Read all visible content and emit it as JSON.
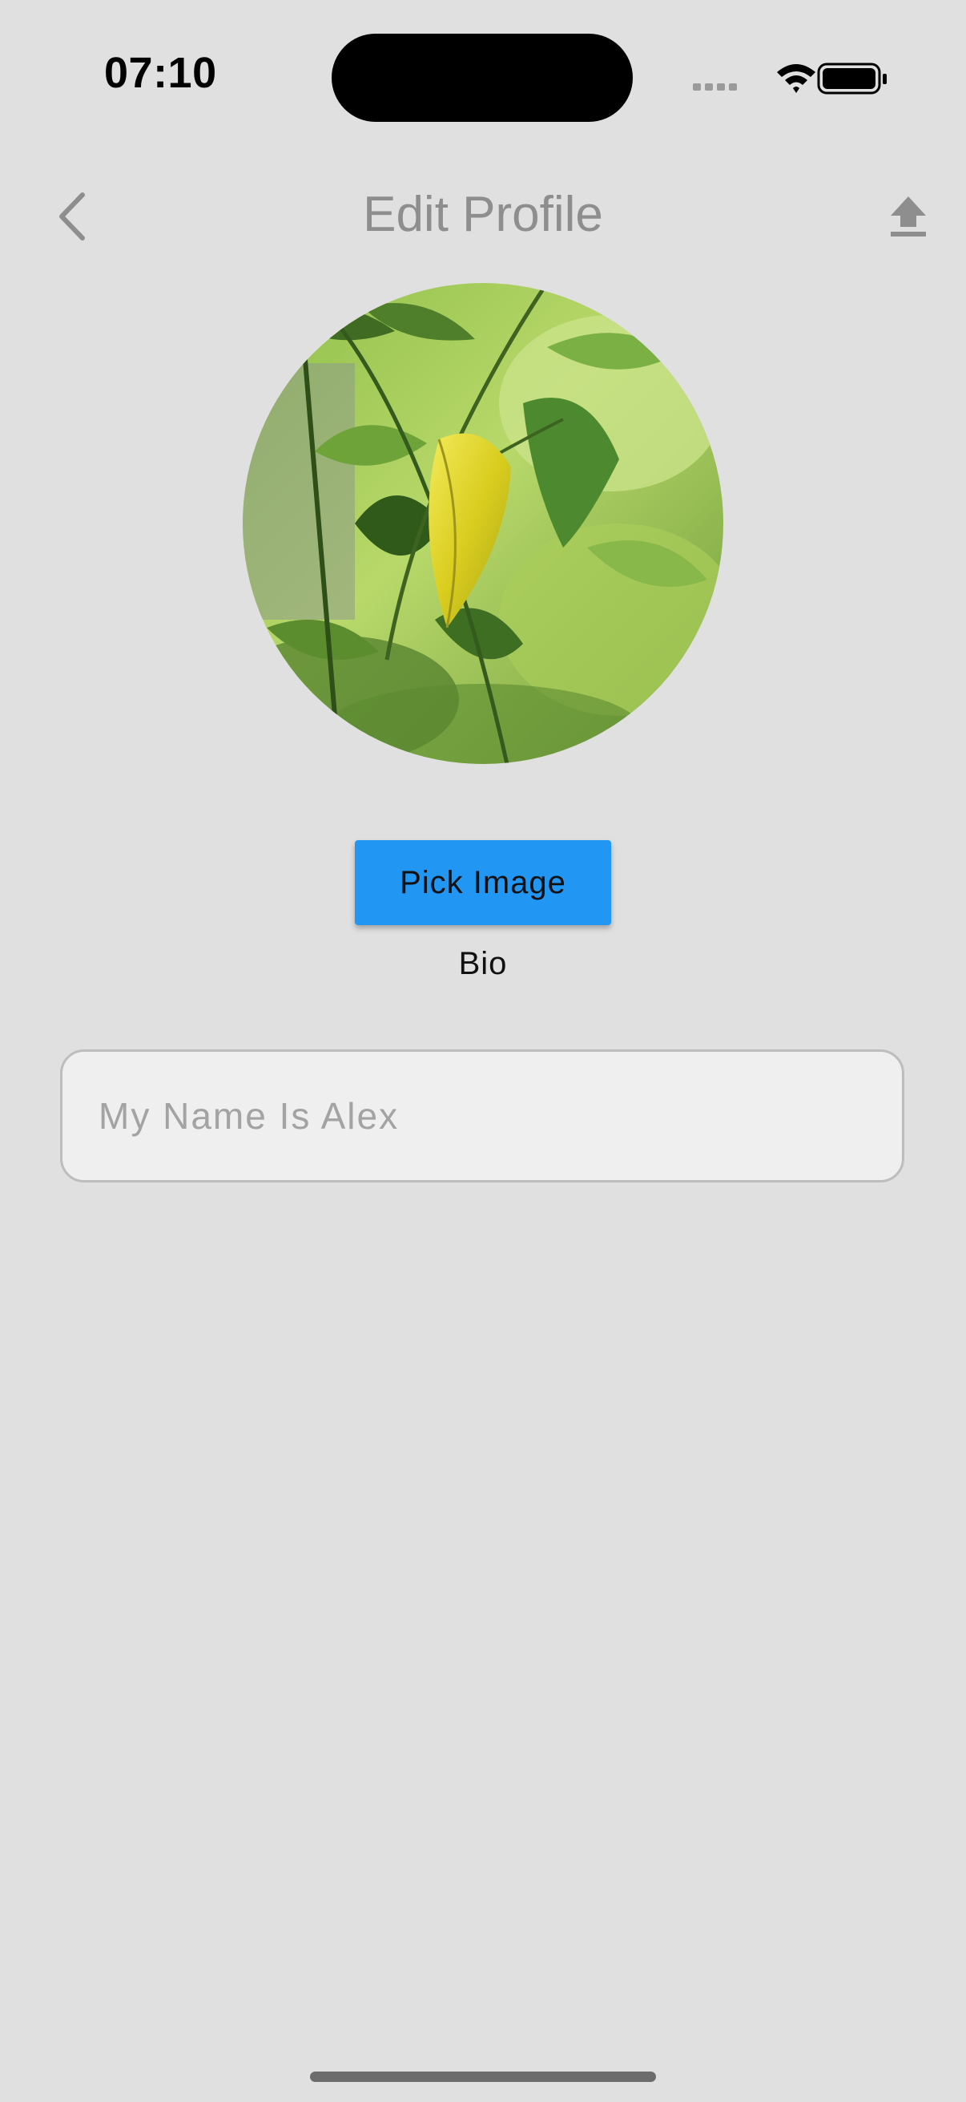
{
  "status_bar": {
    "time": "07:10",
    "signal_icon": "cellular-signal-icon",
    "wifi_icon": "wifi-icon",
    "battery_icon": "battery-icon"
  },
  "nav": {
    "title": "Edit Profile",
    "back_icon": "chevron-left-icon",
    "upload_icon": "upload-icon"
  },
  "profile": {
    "avatar_description": "photo of green leaves with one yellow leaf"
  },
  "actions": {
    "pick_image_label": "Pick Image"
  },
  "bio": {
    "label": "Bio",
    "placeholder": "My Name Is Alex",
    "value": ""
  },
  "colors": {
    "background": "#e0e0e0",
    "accent": "#2196f3",
    "title": "#8e8e8e",
    "input_background": "#efefef",
    "input_border": "#bdbdbd"
  }
}
